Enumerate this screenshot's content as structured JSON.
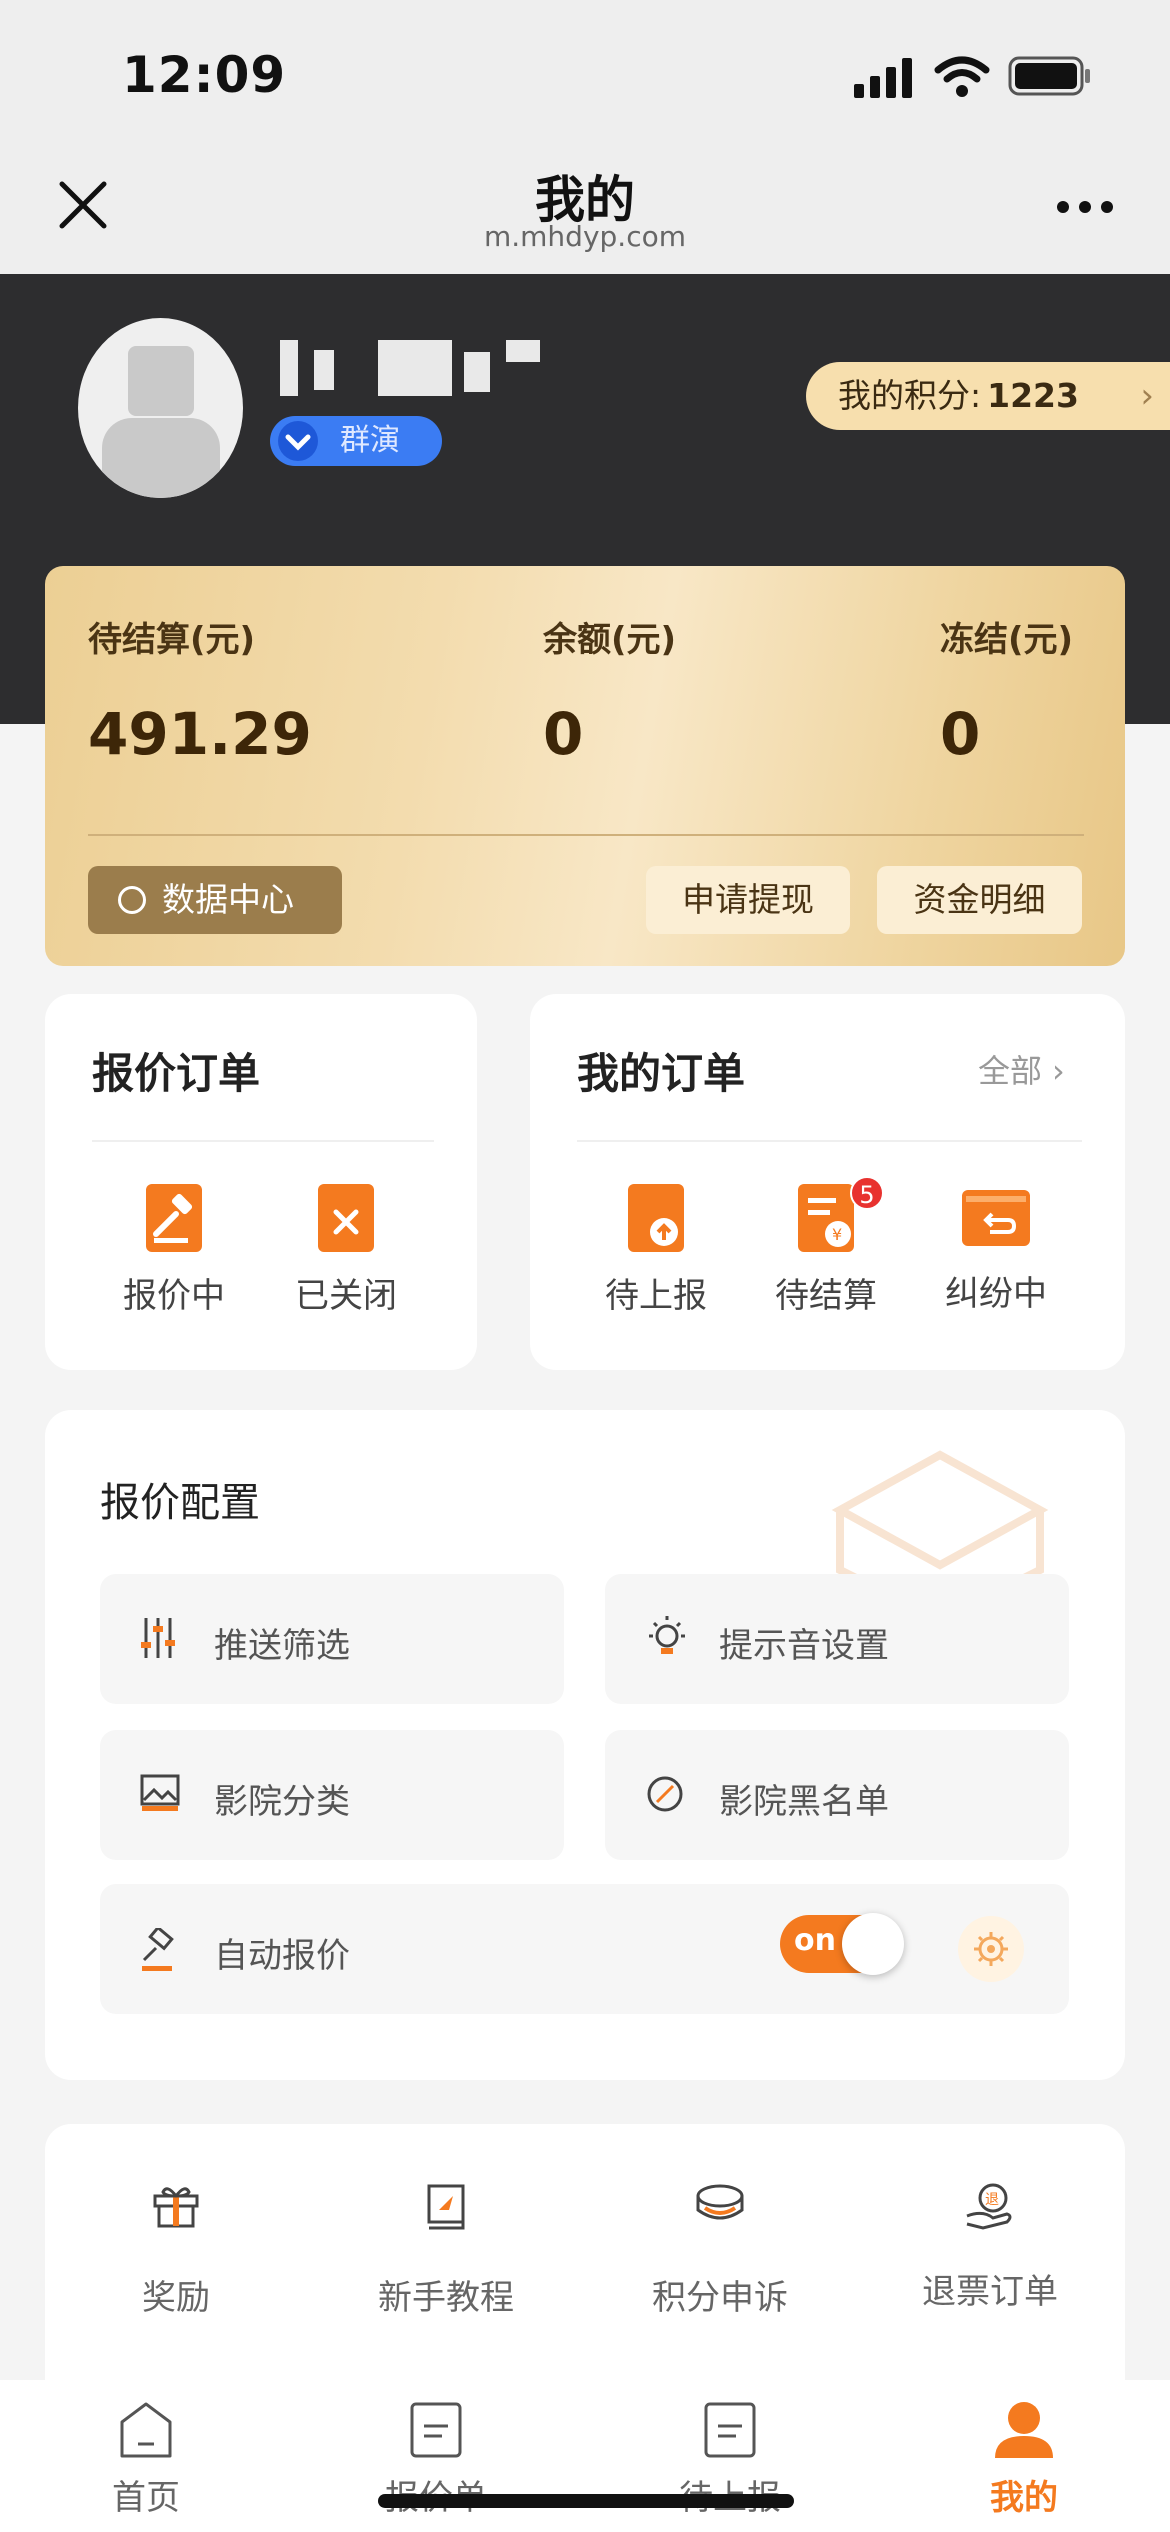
{
  "status": {
    "time": "12:09"
  },
  "nav": {
    "title": "我的",
    "subtitle": "m.mhdyp.com"
  },
  "profile": {
    "badge": "群演",
    "points_label": "我的积分:",
    "points_value": "1223"
  },
  "balance": {
    "pending_label": "待结算(元)",
    "pending_value": "491.29",
    "balance_label": "余额(元)",
    "balance_value": "0",
    "frozen_label": "冻结(元)",
    "frozen_value": "0",
    "data_center": "数据中心",
    "withdraw": "申请提现",
    "details": "资金明细"
  },
  "quote_orders": {
    "title": "报价订单",
    "items": [
      "报价中",
      "已关闭"
    ]
  },
  "my_orders": {
    "title": "我的订单",
    "all": "全部",
    "items": [
      "待上报",
      "待结算",
      "纠纷中"
    ],
    "pending_count": "5"
  },
  "config": {
    "title": "报价配置",
    "push_filter": "推送筛选",
    "sound": "提示音设置",
    "cinema_category": "影院分类",
    "cinema_blacklist": "影院黑名单",
    "auto_quote": "自动报价",
    "toggle": "on"
  },
  "misc": {
    "items": [
      "奖励",
      "新手教程",
      "积分申诉",
      "退票订单"
    ]
  },
  "tabs": {
    "items": [
      "首页",
      "报价单",
      "待上报",
      "我的"
    ],
    "active_color": "#f47a1f"
  },
  "colors": {
    "accent": "#f47a1f",
    "dark_header": "#2d2d2f",
    "gold": "#eccf94"
  }
}
